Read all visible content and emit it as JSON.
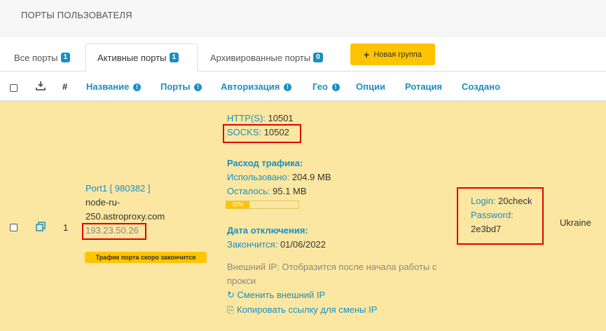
{
  "page": {
    "title": "ПОРТЫ ПОЛЬЗОВАТЕЛЯ"
  },
  "tabs": [
    {
      "label": "Все порты",
      "count": "1"
    },
    {
      "label": "Активные порты",
      "count": "1"
    },
    {
      "label": "Архивированные порты",
      "count": "0"
    }
  ],
  "new_group_button": {
    "icon": "+",
    "label": "Новая группа"
  },
  "table": {
    "headers": {
      "index": "#",
      "name": "Название",
      "ports": "Порты",
      "auth": "Авторизация",
      "geo": "Гео",
      "options": "Опции",
      "rotation": "Ротация",
      "created": "Создано"
    },
    "row": {
      "index": "1",
      "port_name": "Port1 [ 980382 ]",
      "host_line1": "node-ru-",
      "host_line2": "250.astroproxy.com",
      "ip": "193.23.50.26",
      "warning": "Трафик порта скоро закончится",
      "http_label": "HTTP(S):",
      "http_port": "10501",
      "socks_label": "SOCKS:",
      "socks_port": "10502",
      "traffic_title": "Расход трафика:",
      "used_label": "Использовано:",
      "used_value": "204.9 MB",
      "left_label": "Осталось:",
      "left_value": "95.1 MB",
      "progress_label": "32%",
      "progress_fraction": 0.32,
      "shutdown_title": "Дата отключения:",
      "ends_label": "Закончится:",
      "ends_value": "01/06/2022",
      "external_ip_line1": "Внешний IP: Отобразится после начала работы с",
      "external_ip_line2": "прокси",
      "change_ip": "Сменить внешний IP",
      "copy_link": "Копировать ссылку для смены IP",
      "login_label": "Login:",
      "login_value": "20check",
      "password_label": "Password:",
      "password_value": "2e3bd7",
      "geo": "Ukraine"
    }
  },
  "colors": {
    "accent": "#1a8ec4",
    "highlight_row": "#fbe7a1",
    "yellow": "#ffc400",
    "red_box": "#e00000"
  }
}
